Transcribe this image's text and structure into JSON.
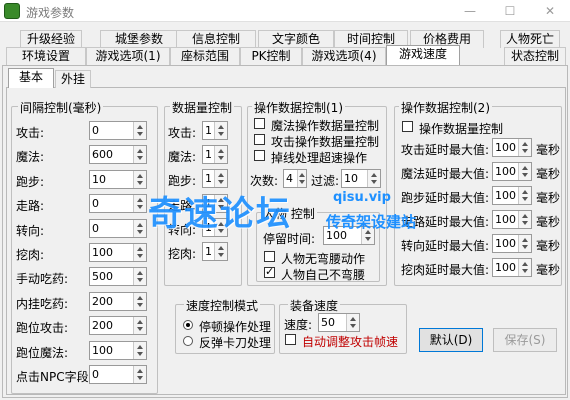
{
  "window": {
    "title": "游戏参数"
  },
  "tabs_row1": [
    "升级经验",
    "城堡参数",
    "信息控制",
    "文字颜色",
    "时间控制",
    "价格费用",
    "人物死亡"
  ],
  "tabs_row2": [
    "环境设置",
    "游戏选项(1)",
    "座标范围",
    "PK控制",
    "游戏选项(4)",
    "游戏速度",
    "状态控制"
  ],
  "selected_tab": "游戏速度",
  "subtabs": [
    "基本",
    "外挂"
  ],
  "interval": {
    "title": "间隔控制(毫秒)",
    "rows": [
      {
        "label": "攻击:",
        "value": "0"
      },
      {
        "label": "魔法:",
        "value": "600"
      },
      {
        "label": "跑步:",
        "value": "10"
      },
      {
        "label": "走路:",
        "value": "0"
      },
      {
        "label": "转向:",
        "value": "0"
      },
      {
        "label": "挖肉:",
        "value": "100"
      },
      {
        "label": "手动吃药:",
        "value": "500"
      },
      {
        "label": "内挂吃药:",
        "value": "200"
      },
      {
        "label": "跑位攻击:",
        "value": "200"
      },
      {
        "label": "跑位魔法:",
        "value": "100"
      },
      {
        "label": "点击NPC字段:",
        "value": "0"
      }
    ]
  },
  "count": {
    "title": "数据量控制",
    "rows": [
      {
        "label": "攻击:",
        "value": "1"
      },
      {
        "label": "魔法:",
        "value": "1"
      },
      {
        "label": "跑步:",
        "value": "1"
      },
      {
        "label": "走路:",
        "value": "1"
      },
      {
        "label": "转向:",
        "value": "1"
      },
      {
        "label": "挖肉:",
        "value": "1"
      }
    ]
  },
  "op1": {
    "title": "操作数据控制(1)",
    "checks": [
      {
        "label": "魔法操作数据量控制",
        "checked": false
      },
      {
        "label": "攻击操作数据量控制",
        "checked": false
      },
      {
        "label": "掉线处理超速操作",
        "checked": false
      }
    ],
    "times_label": "次数:",
    "times_value": "4",
    "filter_label": "过滤:",
    "filter_value": "10",
    "sub_title": "人物     控制",
    "stay_label": "停留时间:",
    "stay_value": "100",
    "checks2": [
      {
        "label": "人物无弯腰动作",
        "checked": false
      },
      {
        "label": "人物自己不弯腰",
        "checked": true
      }
    ]
  },
  "op2": {
    "title": "操作数据控制(2)",
    "check": {
      "label": "操作数据量控制",
      "checked": false
    },
    "unit": "毫秒",
    "rows": [
      {
        "label": "攻击延时最大值:",
        "value": "100"
      },
      {
        "label": "魔法延时最大值:",
        "value": "100"
      },
      {
        "label": "跑步延时最大值:",
        "value": "100"
      },
      {
        "label": "走路延时最大值:",
        "value": "100"
      },
      {
        "label": "转向延时最大值:",
        "value": "100"
      },
      {
        "label": "挖肉延时最大值:",
        "value": "100"
      }
    ]
  },
  "mode": {
    "title": "速度控制模式",
    "options": [
      {
        "label": "停顿操作处理",
        "selected": true
      },
      {
        "label": "反弹卡刀处理",
        "selected": false
      }
    ]
  },
  "equip": {
    "title": "装备速度",
    "speed_label": "速度:",
    "speed_value": "50",
    "auto": {
      "label": "自动调整攻击帧速",
      "checked": false,
      "color": "#c00000"
    }
  },
  "buttons": {
    "default": "默认(D)",
    "save": "保存(S)"
  },
  "watermark": {
    "main": "奇速论坛",
    "domain": "qisu.vip",
    "sub": "传奇架设建站"
  },
  "colors": {
    "accent": "#1e90ff",
    "tab_selected": "#ffffff"
  }
}
